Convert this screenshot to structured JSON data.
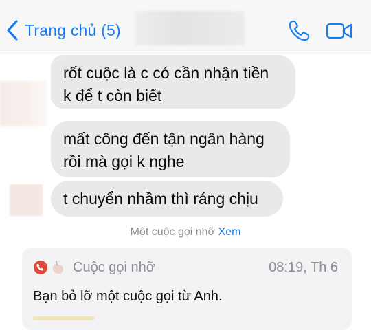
{
  "header": {
    "back_label": "Trang chủ (5)",
    "back_icon": "chevron-left-icon",
    "call_icon": "phone-icon",
    "video_icon": "video-camera-icon",
    "accent_color": "#1a7cf5"
  },
  "messages": [
    {
      "lines": [
        "rốt cuộc là c có cần nhận tiền",
        "k để t còn biết"
      ]
    },
    {
      "lines": [
        "mất công đến tận ngân hàng",
        "rồi mà gọi k nghe"
      ]
    },
    {
      "lines": [
        "t chuyển nhầm thì ráng chịu"
      ]
    }
  ],
  "missed_notice": {
    "text": "Một cuộc gọi nhỡ",
    "action": "Xem"
  },
  "call_card": {
    "icon": "missed-call-icon",
    "title": "Cuộc gọi nhỡ",
    "time": "08:19, Th 6",
    "body": "Bạn bỏ lỡ một cuộc gọi từ Anh.",
    "icon_color": "#e0463a"
  }
}
